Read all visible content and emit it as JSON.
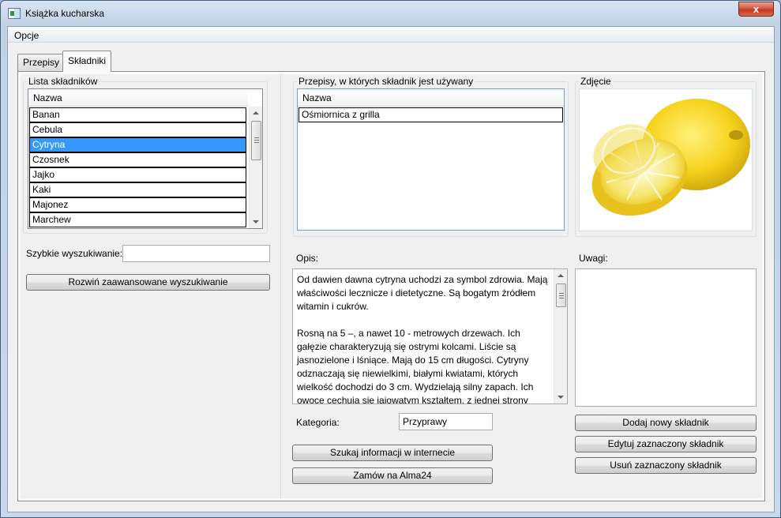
{
  "window": {
    "title": "Książka kucharska",
    "close_glyph": "x"
  },
  "menu": {
    "items": [
      "Opcje"
    ]
  },
  "tabs": [
    {
      "label": "Przepisy",
      "active": false
    },
    {
      "label": "Składniki",
      "active": true
    }
  ],
  "ingredients": {
    "group_title": "Lista składników",
    "column_header": "Nazwa",
    "items": [
      "Banan",
      "Cebula",
      "Cytryna",
      "Czosnek",
      "Jajko",
      "Kaki",
      "Majonez",
      "Marchew"
    ],
    "selected_index": 2,
    "quick_search_label": "Szybkie wyszukiwanie:",
    "quick_search_value": "",
    "advanced_search_button": "Rozwiń zaawansowane wyszukiwanie"
  },
  "recipes_using": {
    "group_title": "Przepisy, w których składnik jest używany",
    "column_header": "Nazwa",
    "items": [
      "Ośmiornica z grilla"
    ]
  },
  "photo": {
    "group_title": "Zdjęcie",
    "subject": "lemon-photo"
  },
  "description": {
    "label": "Opis:",
    "text": "Od dawien dawna cytryna uchodzi za symbol zdrowia. Mają właściwości lecznicze i dietetyczne. Są bogatym źródłem witamin i cukrów.\n\nRosną na 5 –, a nawet 10 - metrowych drzewach. Ich gałęzie charakteryzują się ostrymi kolcami. Liście są jasnozielone i lśniące. Mają do 15 cm długości. Cytryny odznaczają się niewielkimi, białymi kwiatami, których wielkość dochodzi do 3 cm. Wydzielają silny zapach. Ich owoce cechują się jajowatym kształtem, z jednej strony zakończonym spiczasto. Mają twardą, żółtą i błyszczącą skórkę. Cechuje się cze"
  },
  "category": {
    "label": "Kategoria:",
    "value": "Przyprawy"
  },
  "notes": {
    "label": "Uwagi:",
    "value": ""
  },
  "buttons": {
    "search_internet": "Szukaj informacji w internecie",
    "order": "Zamów na Alma24",
    "add": "Dodaj nowy składnik",
    "edit": "Edytuj zaznaczony składnik",
    "delete": "Usuń zaznaczony składnik"
  },
  "colors": {
    "selection": "#3399ff",
    "lemon": "#f5d21c",
    "close_button": "#c23a1f"
  }
}
